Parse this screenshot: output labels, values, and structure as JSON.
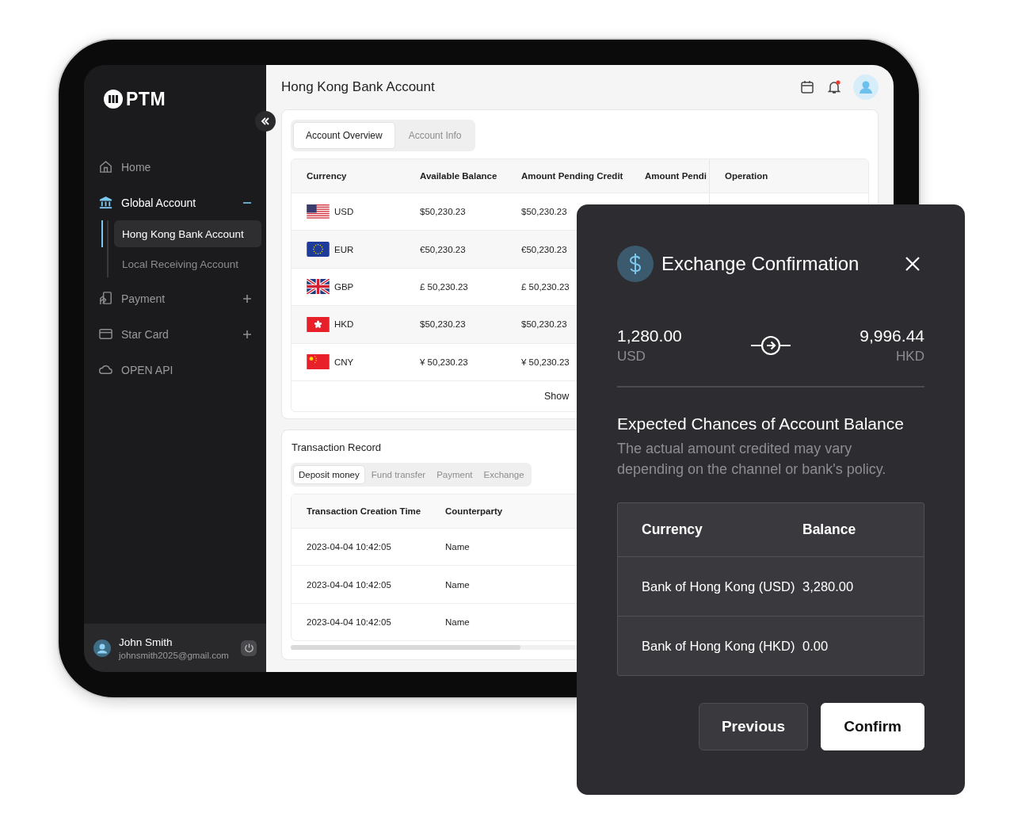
{
  "sidebar": {
    "logo": "PTM",
    "items": [
      {
        "label": "Home",
        "kind": "link",
        "selected": false
      },
      {
        "label": "Global Account",
        "kind": "group",
        "selected": true,
        "expanded": true,
        "children": [
          {
            "label": "Hong Kong Bank Account",
            "selected": true
          },
          {
            "label": "Local Receiving Account",
            "selected": false
          }
        ]
      },
      {
        "label": "Payment",
        "kind": "group",
        "selected": false,
        "expanded": false
      },
      {
        "label": "Star Card",
        "kind": "group",
        "selected": false,
        "expanded": false
      },
      {
        "label": "OPEN API",
        "kind": "link",
        "selected": false
      }
    ],
    "user": {
      "name": "John Smith",
      "email": "johnsmith2025@gmail.com"
    }
  },
  "header": {
    "title": "Hong Kong Bank Account",
    "has_notification": true
  },
  "account": {
    "tabs": [
      {
        "label": "Account Overview",
        "selected": true
      },
      {
        "label": "Account Info",
        "selected": false
      }
    ],
    "columns": [
      "Currency",
      "Available Balance",
      "Amount Pending Credit",
      "Amount Pendi",
      "Operation"
    ],
    "rows": [
      {
        "currency": "USD",
        "available": "$50,230.23",
        "pending_credit": "$50,230.23"
      },
      {
        "currency": "EUR",
        "available": "€50,230.23",
        "pending_credit": "€50,230.23"
      },
      {
        "currency": "GBP",
        "available": "£ 50,230.23",
        "pending_credit": "£ 50,230.23"
      },
      {
        "currency": "HKD",
        "available": "$50,230.23",
        "pending_credit": "$50,230.23"
      },
      {
        "currency": "CNY",
        "available": "¥ 50,230.23",
        "pending_credit": "¥ 50,230.23"
      }
    ],
    "show_more": "Show"
  },
  "transactions": {
    "title": "Transaction Record",
    "tabs": [
      {
        "label": "Deposit money",
        "selected": true
      },
      {
        "label": "Fund transfer",
        "selected": false
      },
      {
        "label": "Payment",
        "selected": false
      },
      {
        "label": "Exchange",
        "selected": false
      }
    ],
    "columns": [
      "Transaction Creation Time",
      "Counterparty"
    ],
    "rows": [
      {
        "time": "2023-04-04 10:42:05",
        "counterparty": "Name"
      },
      {
        "time": "2023-04-04 10:42:05",
        "counterparty": "Name"
      },
      {
        "time": "2023-04-04 10:42:05",
        "counterparty": "Name"
      }
    ]
  },
  "modal": {
    "title": "Exchange Confirmation",
    "from": {
      "amount": "1,280.00",
      "currency": "USD"
    },
    "to": {
      "amount": "9,996.44",
      "currency": "HKD"
    },
    "heading": "Expected Chances of Account Balance",
    "description": "The actual amount credited may vary depending on the channel or bank's policy.",
    "columns": [
      "Currency",
      "Balance"
    ],
    "rows": [
      {
        "account": "Bank of Hong Kong (USD)",
        "balance": "3,280.00"
      },
      {
        "account": "Bank of Hong Kong (HKD)",
        "balance": "0.00"
      }
    ],
    "buttons": [
      {
        "label": "Previous",
        "kind": "secondary"
      },
      {
        "label": "Confirm",
        "kind": "primary"
      }
    ]
  }
}
